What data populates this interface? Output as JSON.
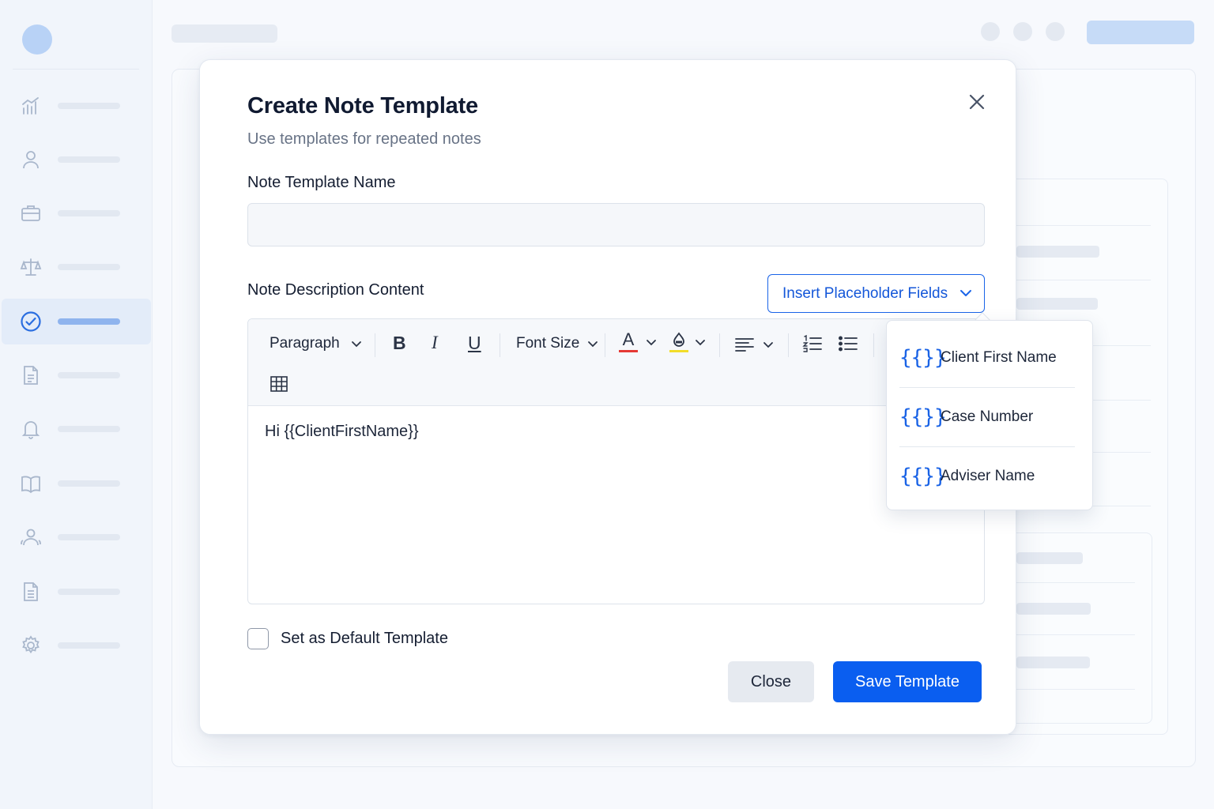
{
  "modal": {
    "title": "Create Note Template",
    "subtitle": "Use templates for repeated notes",
    "name_label": "Note Template Name",
    "name_value": "",
    "content_label": "Note Description Content",
    "insert_button": "Insert Placeholder Fields",
    "editor_content": "Hi {{ClientFirstName}}",
    "checkbox_label": "Set as Default Template",
    "checkbox_checked": false,
    "close_button": "Close",
    "save_button": "Save Template"
  },
  "toolbar": {
    "block_format": "Paragraph",
    "font_size": "Font Size",
    "bold": "B",
    "italic": "I",
    "underline": "U",
    "text_color_glyph": "A",
    "text_color": "#e53935",
    "highlight_color": "#f2dd2a"
  },
  "placeholder_menu": {
    "items": [
      {
        "icon": "{{}}",
        "label": "Client First Name"
      },
      {
        "icon": "{{}}",
        "label": "Case Number"
      },
      {
        "icon": "{{}}",
        "label": "Adviser Name"
      }
    ]
  },
  "sidebar": {
    "items": [
      {
        "icon": "analytics-icon"
      },
      {
        "icon": "user-icon"
      },
      {
        "icon": "briefcase-icon"
      },
      {
        "icon": "scales-icon"
      },
      {
        "icon": "check-circle-icon",
        "active": true
      },
      {
        "icon": "document-icon"
      },
      {
        "icon": "bell-icon"
      },
      {
        "icon": "book-icon"
      },
      {
        "icon": "users-icon"
      },
      {
        "icon": "file-icon"
      },
      {
        "icon": "gear-icon"
      }
    ]
  },
  "colors": {
    "accent": "#0a5ef0",
    "sidebar_active": "#e3ecf9"
  }
}
